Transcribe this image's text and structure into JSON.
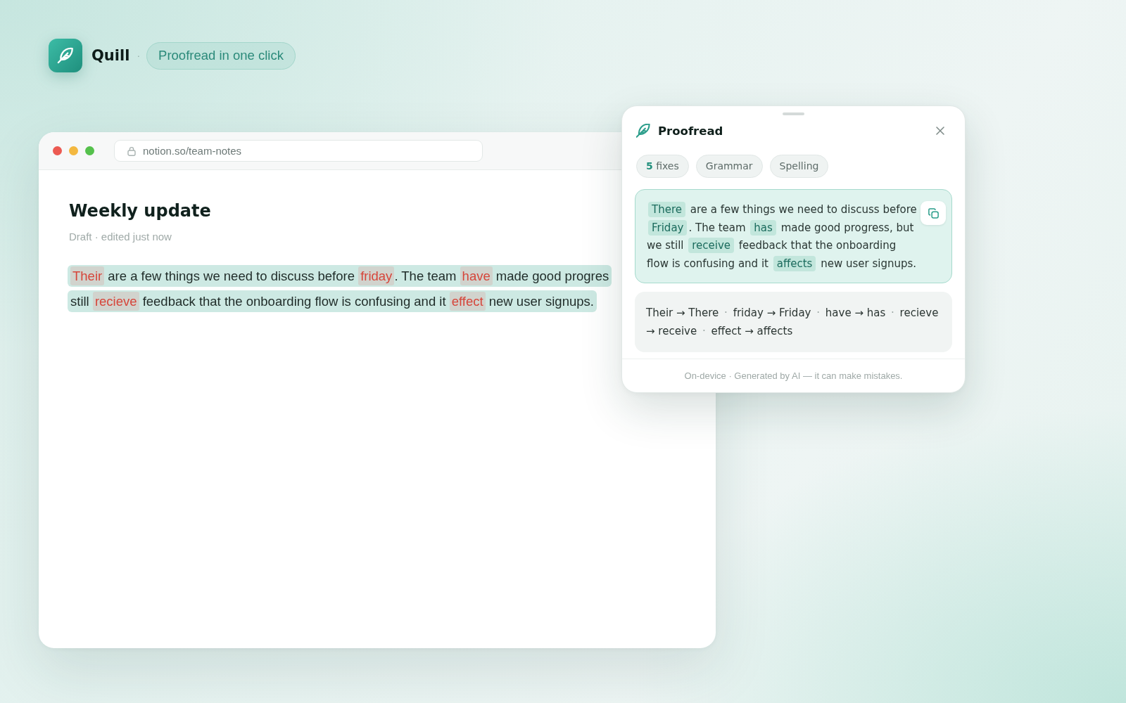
{
  "brand": {
    "name": "Quill",
    "separator": "·",
    "tagline": "Proofread in one click"
  },
  "browser": {
    "url": "notion.so/team-notes"
  },
  "document": {
    "title": "Weekly update",
    "meta": "Draft · edited just now",
    "paragraph": {
      "selected": true,
      "lines": [
        {
          "segments": [
            {
              "text": "Their",
              "kind": "error"
            },
            {
              "text": " are a few things we need to discuss before ",
              "kind": "plain"
            },
            {
              "text": "friday",
              "kind": "error"
            },
            {
              "text": ". The team ",
              "kind": "plain"
            },
            {
              "text": "have",
              "kind": "error"
            },
            {
              "text": " made good progres",
              "kind": "plain"
            }
          ]
        },
        {
          "segments": [
            {
              "text": "still ",
              "kind": "plain"
            },
            {
              "text": "recieve",
              "kind": "error"
            },
            {
              "text": " feedback that the onboarding flow is confusing and it ",
              "kind": "plain"
            },
            {
              "text": "effect",
              "kind": "error"
            },
            {
              "text": " new user signups.",
              "kind": "plain"
            }
          ]
        }
      ]
    }
  },
  "proofread_panel": {
    "title": "Proofread",
    "chips": [
      {
        "label": "**5** fixes"
      },
      {
        "label": "Grammar"
      },
      {
        "label": "Spelling"
      }
    ],
    "corrected_text": [
      {
        "text": "There",
        "kind": "fix"
      },
      {
        "text": " are a few things we need to discuss before ",
        "kind": "plain"
      },
      {
        "text": "Friday",
        "kind": "fix"
      },
      {
        "text": ". The team ",
        "kind": "plain"
      },
      {
        "text": "has",
        "kind": "fix"
      },
      {
        "text": " made good progress, but we still ",
        "kind": "plain"
      },
      {
        "text": "receive",
        "kind": "fix"
      },
      {
        "text": " feedback that the onboarding flow is confusing and it ",
        "kind": "plain"
      },
      {
        "text": "affects",
        "kind": "fix"
      },
      {
        "text": " new user signups.",
        "kind": "plain"
      }
    ],
    "suggestions": {
      "arrow": "→",
      "separator": "·",
      "items": [
        {
          "from": "Their",
          "to": "There"
        },
        {
          "from": "friday",
          "to": "Friday"
        },
        {
          "from": "have",
          "to": "has"
        },
        {
          "from": "recieve",
          "to": "receive"
        },
        {
          "from": "effect",
          "to": "affects"
        }
      ]
    },
    "footer": "On-device · Generated by AI — it can make mistakes."
  }
}
